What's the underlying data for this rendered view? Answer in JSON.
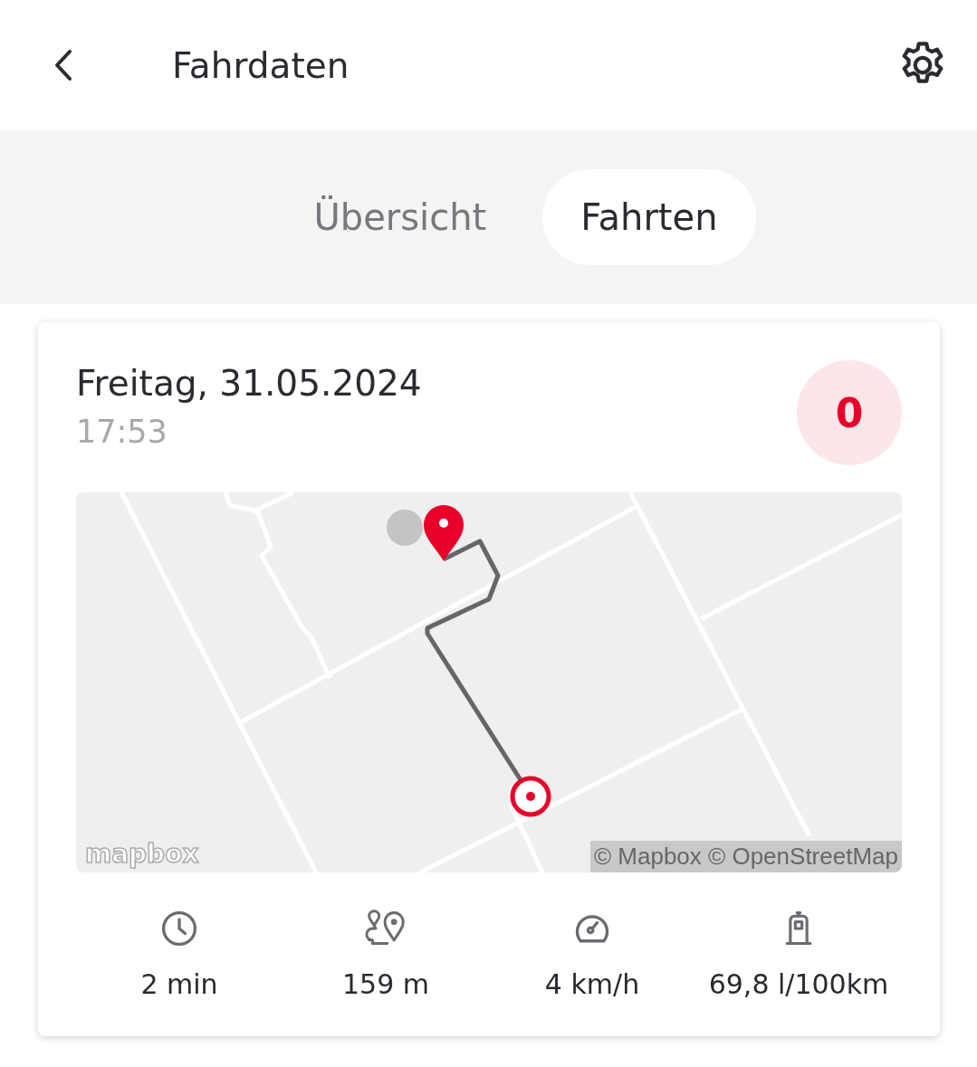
{
  "header": {
    "title": "Fahrdaten"
  },
  "tabs": [
    {
      "label": "Übersicht",
      "selected": false
    },
    {
      "label": "Fahrten",
      "selected": true
    }
  ],
  "trip": {
    "date": "Freitag, 31.05.2024",
    "time": "17:53",
    "score": "0",
    "map": {
      "kind": "picture",
      "attribution": "© Mapbox © OpenStreetMap",
      "logo": "mapbox"
    },
    "stats": [
      {
        "kind": "duration",
        "value": "2 min"
      },
      {
        "kind": "distance",
        "value": "159 m"
      },
      {
        "kind": "speed",
        "value": "4 km/h"
      },
      {
        "kind": "fuel",
        "value": "69,8 l/100km"
      }
    ]
  }
}
